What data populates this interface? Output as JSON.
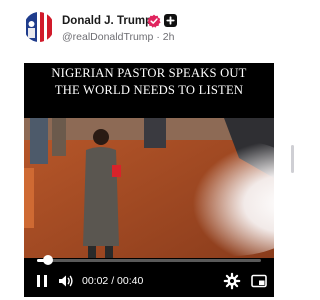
{
  "author": {
    "name": "Donald J. Trump",
    "handle": "@realDonaldTrump",
    "separator": "·",
    "time_ago": "2h"
  },
  "video": {
    "title_lines": [
      "NIGERIAN PASTOR SPEAKS OUT",
      "THE WORLD NEEDS TO LISTEN"
    ],
    "current_time": "00:02",
    "time_separator": "/",
    "duration": "00:40",
    "progress_fraction": 0.05
  },
  "icons": {
    "verified": "verified-check-icon",
    "plus": "plus-badge-icon",
    "pause": "pause-icon",
    "volume": "volume-icon",
    "settings": "gear-icon",
    "pip": "picture-in-picture-icon"
  },
  "colors": {
    "verified_badge": "#e0245e",
    "name_text": "#1a1a1a",
    "muted_text": "#6e6e73",
    "video_bg": "#000000"
  }
}
